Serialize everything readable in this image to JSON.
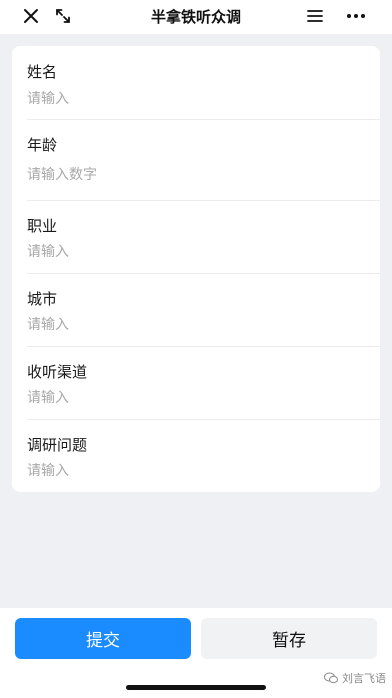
{
  "header": {
    "title": "半拿铁听众调",
    "icons": [
      "close-icon",
      "shrink-icon",
      "menu-icon",
      "more-icon"
    ]
  },
  "form": {
    "fields": [
      {
        "label": "姓名",
        "placeholder": "请输入"
      },
      {
        "label": "年龄",
        "placeholder": "请输入数字"
      },
      {
        "label": "职业",
        "placeholder": "请输入"
      },
      {
        "label": "城市",
        "placeholder": "请输入"
      },
      {
        "label": "收听渠道",
        "placeholder": "请输入"
      },
      {
        "label": "调研问题",
        "placeholder": "请输入"
      }
    ]
  },
  "actions": {
    "submit_label": "提交",
    "save_label": "暂存"
  },
  "watermark": {
    "text": "刘言飞语"
  },
  "colors": {
    "primary": "#1a8cff",
    "background": "#eef0f3",
    "placeholder": "#a8a8a8"
  }
}
